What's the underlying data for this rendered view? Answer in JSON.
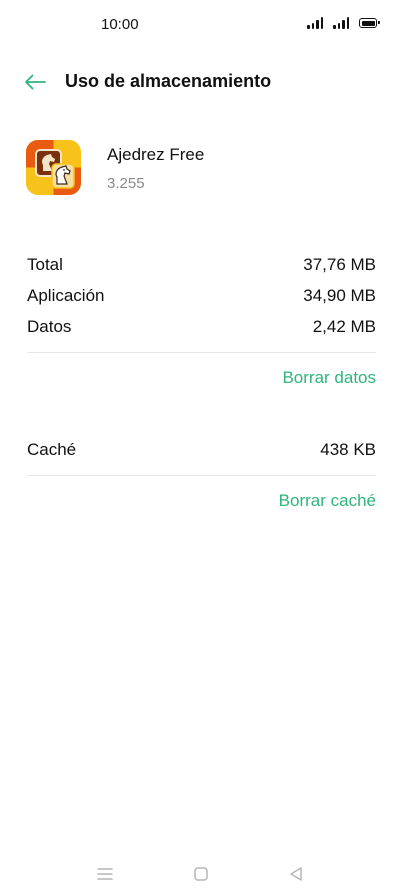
{
  "status_bar": {
    "time": "10:00"
  },
  "header": {
    "title": "Uso de almacenamiento",
    "back_icon": "arrow-left-icon"
  },
  "app": {
    "name": "Ajedrez Free",
    "version": "3.255",
    "icon": "chess-knight-icon"
  },
  "storage": {
    "rows": [
      {
        "label": "Total",
        "value": "37,76 MB"
      },
      {
        "label": "Aplicación",
        "value": "34,90 MB"
      },
      {
        "label": "Datos",
        "value": "2,42 MB"
      }
    ],
    "clear_data_label": "Borrar datos"
  },
  "cache": {
    "label": "Caché",
    "value": "438 KB",
    "clear_cache_label": "Borrar caché"
  },
  "nav_bar": {
    "menu_icon": "menu-icon",
    "home_icon": "square-home-icon",
    "back_icon": "triangle-back-icon"
  },
  "colors": {
    "accent": "#2fb57d",
    "secondary_text": "#8a8a8a",
    "divider": "#e6e6e6"
  }
}
